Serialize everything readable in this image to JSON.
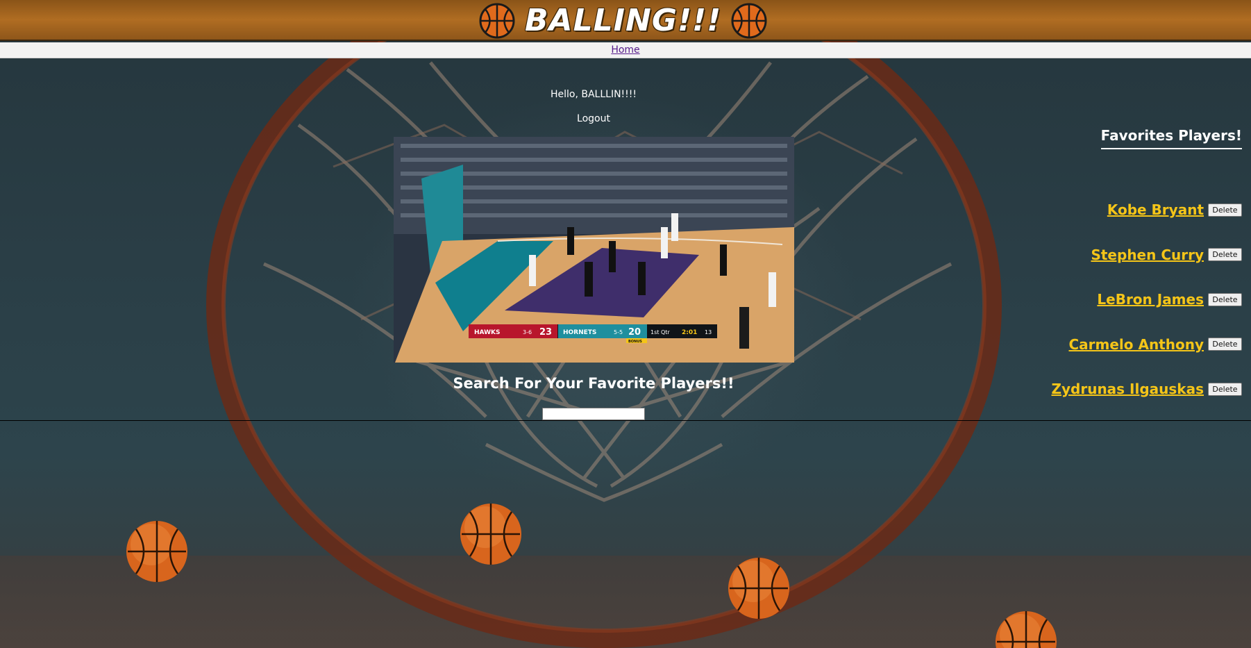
{
  "header": {
    "title": "BALLING!!!",
    "left_icon": "basketball-icon",
    "right_icon": "basketball-icon"
  },
  "nav": {
    "home_label": "Home"
  },
  "main": {
    "greeting": "Hello, BALLLIN!!!!",
    "logout_label": "Logout",
    "video": {
      "scorebug": {
        "away_team": "HAWKS",
        "away_record": "3-6",
        "away_score": "23",
        "home_team": "HORNETS",
        "home_record": "5-5",
        "home_score": "20",
        "period": "1st Qtr",
        "clock": "2:01",
        "shot_clock": "13",
        "bonus": "BONUS"
      }
    },
    "search_heading": "Search For Your Favorite Players!!",
    "search_value": ""
  },
  "favorites": {
    "heading": "Favorites Players!",
    "delete_label": "Delete",
    "players": [
      {
        "name": "Kobe Bryant"
      },
      {
        "name": "Stephen Curry"
      },
      {
        "name": "LeBron James"
      },
      {
        "name": "Carmelo Anthony"
      },
      {
        "name": "Zydrunas Ilgauskas"
      }
    ]
  },
  "colors": {
    "header_bg": "#b06d22",
    "link_gold": "#f5c518",
    "ball_orange": "#e06a1c"
  }
}
